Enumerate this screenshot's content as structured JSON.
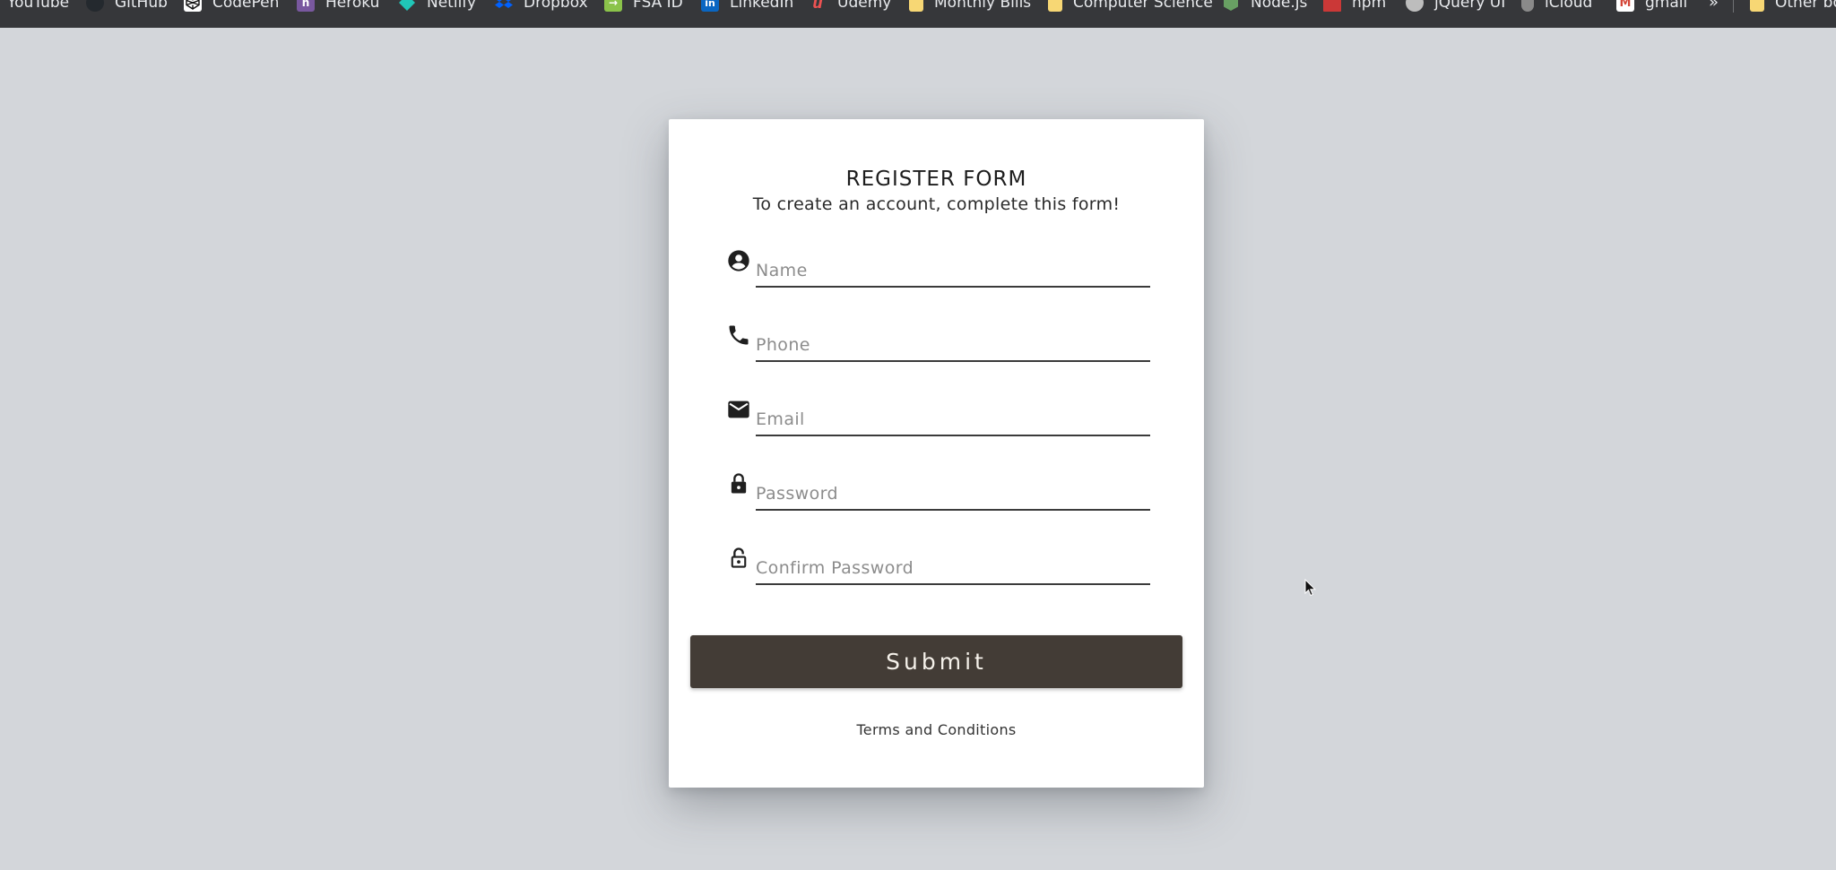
{
  "bookmarks": [
    {
      "label": "YouTube",
      "icon": "youtube-icon",
      "color": "#ff0000"
    },
    {
      "label": "GitHub",
      "icon": "github-icon",
      "color": "#24292e"
    },
    {
      "label": "CodePen",
      "icon": "codepen-icon",
      "color": "#ffffff"
    },
    {
      "label": "Heroku",
      "icon": "heroku-icon",
      "color": "#79589f"
    },
    {
      "label": "Netlify",
      "icon": "netlify-icon",
      "color": "#20c6b7"
    },
    {
      "label": "Dropbox",
      "icon": "dropbox-icon",
      "color": "#0061ff"
    },
    {
      "label": "FSA ID",
      "icon": "fsa-icon",
      "color": "#8bc34a"
    },
    {
      "label": "LinkedIn",
      "icon": "linkedin-icon",
      "color": "#0a66c2"
    },
    {
      "label": "Udemy",
      "icon": "udemy-icon",
      "color": "#ec5252"
    },
    {
      "label": "Monthly Bills",
      "icon": "folder-icon",
      "color": "#f7d774"
    },
    {
      "label": "Computer Science",
      "icon": "folder-icon",
      "color": "#f7d774"
    },
    {
      "label": "Node.js",
      "icon": "nodejs-icon",
      "color": "#68a063"
    },
    {
      "label": "npm",
      "icon": "npm-icon",
      "color": "#cb3837"
    },
    {
      "label": "jQuery UI",
      "icon": "globe-icon",
      "color": "#bdbdbd"
    },
    {
      "label": "iCloud",
      "icon": "apple-icon",
      "color": "#a0a0a0"
    },
    {
      "label": "gmail",
      "icon": "gmail-icon",
      "color": "#d44638"
    },
    {
      "label": "Other bookmarks",
      "icon": "folder-icon",
      "color": "#f7d774"
    }
  ],
  "bookmarks_overflow": "»",
  "form": {
    "title": "REGISTER FORM",
    "subtitle": "To create an account, complete this form!",
    "fields": [
      {
        "name": "name",
        "placeholder": "Name",
        "value": "",
        "icon": "account-circle-icon"
      },
      {
        "name": "phone",
        "placeholder": "Phone",
        "value": "",
        "icon": "phone-icon"
      },
      {
        "name": "email",
        "placeholder": "Email",
        "value": "",
        "icon": "mail-icon"
      },
      {
        "name": "password",
        "placeholder": "Password",
        "value": "",
        "icon": "lock-icon"
      },
      {
        "name": "confirm-password",
        "placeholder": "Confirm Password",
        "value": "",
        "icon": "lock-open-icon"
      }
    ],
    "submit_label": "Submit",
    "terms_label": "Terms and Conditions"
  },
  "colors": {
    "page_background": "#d3d6da",
    "bookmarks_bar": "#36373a",
    "card": "#ffffff",
    "button": "#433c36",
    "button_text": "#f5f1ea"
  }
}
